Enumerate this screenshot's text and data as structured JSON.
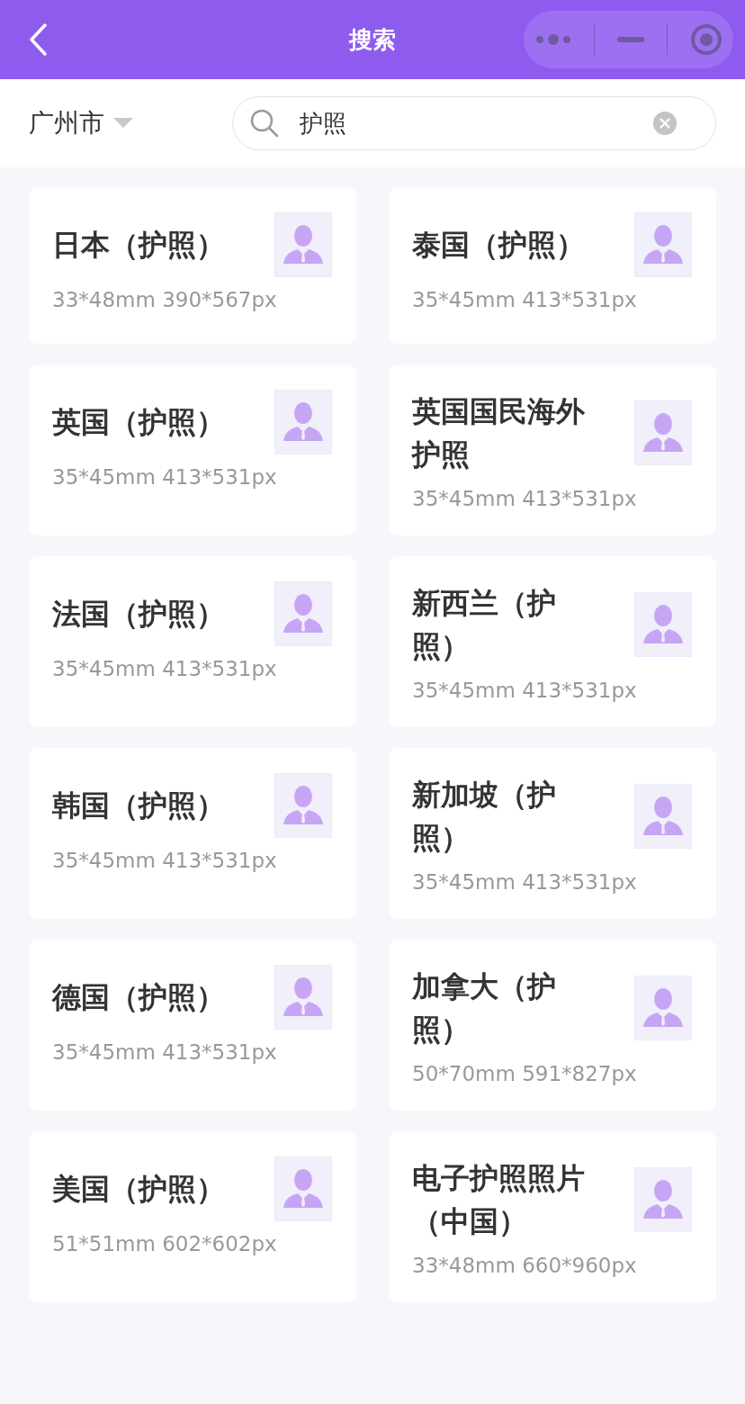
{
  "header": {
    "title": "搜索"
  },
  "toolbar": {
    "city": "广州市",
    "search": {
      "value": "护照"
    }
  },
  "cards": [
    {
      "title": "日本（护照）",
      "spec": "33*48mm 390*567px"
    },
    {
      "title": "泰国（护照）",
      "spec": "35*45mm 413*531px"
    },
    {
      "title": "英国（护照）",
      "spec": "35*45mm 413*531px"
    },
    {
      "title": "英国国民海外护照",
      "spec": "35*45mm 413*531px"
    },
    {
      "title": "法国（护照）",
      "spec": "35*45mm 413*531px"
    },
    {
      "title": "新西兰（护照）",
      "spec": "35*45mm 413*531px"
    },
    {
      "title": "韩国（护照）",
      "spec": "35*45mm 413*531px"
    },
    {
      "title": "新加坡（护照）",
      "spec": "35*45mm 413*531px"
    },
    {
      "title": "德国（护照）",
      "spec": "35*45mm 413*531px"
    },
    {
      "title": "加拿大（护照）",
      "spec": "50*70mm 591*827px"
    },
    {
      "title": "美国（护照）",
      "spec": "51*51mm 602*602px"
    },
    {
      "title": "电子护照照片（中国）",
      "spec": "33*48mm 660*960px"
    }
  ]
}
